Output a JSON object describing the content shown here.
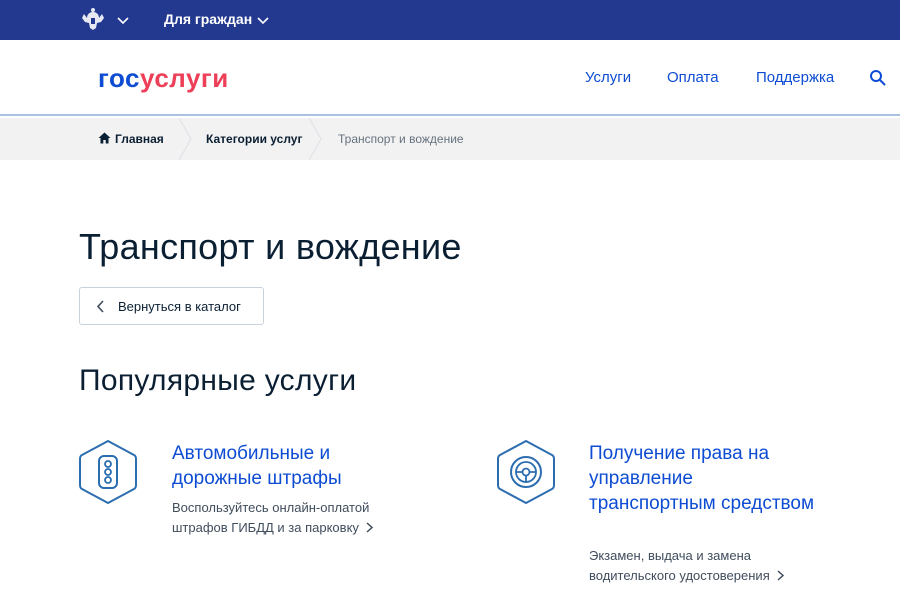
{
  "topbar": {
    "citizens_label": "Для граждан"
  },
  "header": {
    "logo_part1": "гос",
    "logo_part2": "услуги",
    "nav": {
      "services": "Услуги",
      "payment": "Оплата",
      "support": "Поддержка"
    }
  },
  "breadcrumb": {
    "home": "Главная",
    "categories": "Категории услуг",
    "current": "Транспорт и вождение"
  },
  "main": {
    "title": "Транспорт и вождение",
    "back_label": "Вернуться в каталог",
    "popular_title": "Популярные услуги",
    "cards": [
      {
        "title": "Автомобильные и дорожные штрафы",
        "description": "Воспользуйтесь онлайн-оплатой штрафов ГИБДД и за парковку",
        "icon": "traffic-light-icon"
      },
      {
        "title": "Получение права на управление транспортным средством",
        "description": "Экзамен, выдача и замена водительского удостоверения",
        "icon": "steering-wheel-icon"
      }
    ]
  },
  "colors": {
    "topbar_bg": "#233990",
    "brand_blue": "#0d4cd3",
    "brand_red": "#ee3f58",
    "icon_blue": "#2c6db0",
    "breadcrumb_bg": "#f2f2f2"
  }
}
